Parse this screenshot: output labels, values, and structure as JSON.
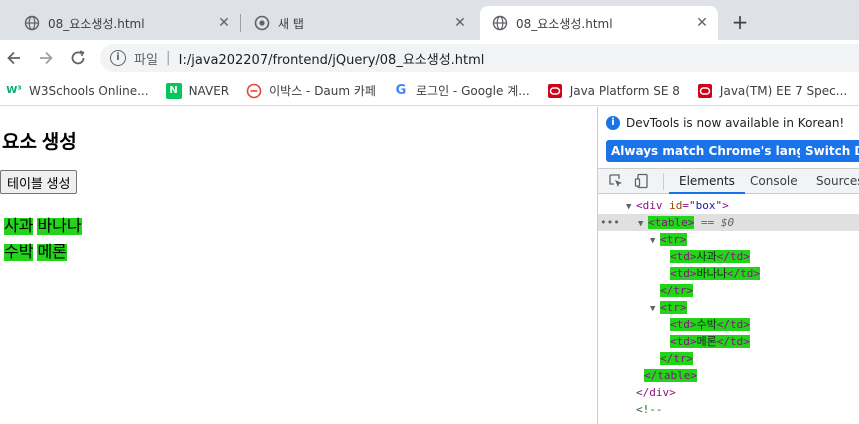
{
  "browser": {
    "tabs": [
      {
        "title": "08_요소생성.html",
        "favicon": "globe-icon",
        "active": false
      },
      {
        "title": "새 탭",
        "favicon": "chrome-icon",
        "active": false
      },
      {
        "title": "08_요소생성.html",
        "favicon": "globe-icon",
        "active": true
      }
    ],
    "new_tab_symbol": "+",
    "close_symbol": "✕",
    "address": {
      "scheme_label": "파일",
      "pipe": "|",
      "url": "I:/java202207/frontend/jQuery/08_요소생성.html"
    },
    "bookmarks": [
      {
        "label": "W3Schools Online...",
        "icon": "w3schools-icon",
        "color": "#04aa6d"
      },
      {
        "label": "NAVER",
        "icon": "naver-icon",
        "color": "#03c75a"
      },
      {
        "label": "이박스 - Daum 카페",
        "icon": "daum-icon",
        "color": "#e2463e"
      },
      {
        "label": "로그인 - Google 계...",
        "icon": "google-icon",
        "color": "#4285f4"
      },
      {
        "label": "Java Platform SE 8",
        "icon": "oracle-icon",
        "color": "#d0021b"
      },
      {
        "label": "Java(TM) EE 7 Spec...",
        "icon": "oracle-icon",
        "color": "#d0021b"
      }
    ]
  },
  "page": {
    "heading": "요소 생성",
    "button_label": "테이블 생성",
    "table": [
      [
        "사과",
        "바나나"
      ],
      [
        "수박",
        "메론"
      ]
    ],
    "highlight_color": "#23d41a"
  },
  "devtools": {
    "notice": "DevTools is now available in Korean!",
    "buttons": [
      "Always match Chrome's language",
      "Switch Dev"
    ],
    "tabs": [
      "Elements",
      "Console",
      "Sources"
    ],
    "active_tab": "Elements",
    "dom": {
      "div_open_tag": "<div",
      "div_attr_name": "id",
      "div_attr_value": "\"box\"",
      "div_close_bracket": ">",
      "table_open": "<table>",
      "selected_marker": "== $0",
      "tr_open": "<tr>",
      "tr_close": "</tr>",
      "td_open": "<td>",
      "td_close": "</td>",
      "table_close": "</table>",
      "div_close": "</div>",
      "comment_start": "<!--",
      "row1": [
        "사과",
        "바나나"
      ],
      "row2": [
        "수박",
        "메론"
      ],
      "dots": "•••"
    }
  }
}
